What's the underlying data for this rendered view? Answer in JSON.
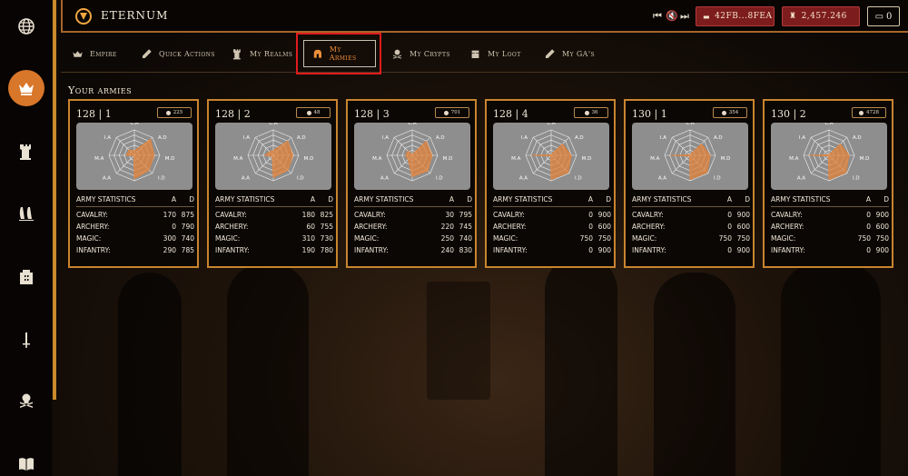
{
  "app": {
    "brand": "ETERNUM",
    "wallet_address": "42FB...8FEA",
    "balance": "2,457.246",
    "wallet_count": "0"
  },
  "sidebar": {
    "items": [
      {
        "icon": "globe-icon",
        "active": false
      },
      {
        "icon": "crown-icon",
        "active": true
      },
      {
        "icon": "tower-icon",
        "active": false
      },
      {
        "icon": "fleet-icon",
        "active": false
      },
      {
        "icon": "building-icon",
        "active": false
      },
      {
        "icon": "sword-icon",
        "active": false
      },
      {
        "icon": "skull-crossbones-icon",
        "active": false
      },
      {
        "icon": "book-icon",
        "active": false
      }
    ]
  },
  "tabs": [
    {
      "label": "Empire",
      "icon": "crown-icon"
    },
    {
      "label": "Quick Actions",
      "icon": "pen-icon"
    },
    {
      "label": "My Realms",
      "icon": "tower-icon"
    },
    {
      "label": "My Armies",
      "icon": "helmet-icon",
      "active": true
    },
    {
      "label": "My Crypts",
      "icon": "skull-crossbones-icon"
    },
    {
      "label": "My Loot",
      "icon": "chest-icon"
    },
    {
      "label": "My GA's",
      "icon": "pen-icon"
    }
  ],
  "section_title": "Your armies",
  "colors": {
    "accent": "#d8762a",
    "border": "#c8842e",
    "highlight": "#e21b1b"
  },
  "stats_headers": {
    "title": "ARMY STATISTICS",
    "attack": "A",
    "defense": "D"
  },
  "radar_labels": [
    "C.A",
    "A.D",
    "M.D",
    "I.D",
    "C.D",
    "A.A",
    "M.A",
    "I.A"
  ],
  "armies": [
    {
      "name": "128 | 1",
      "badge": "225",
      "rows": [
        {
          "label": "CAVALRY:",
          "a": "170",
          "d": "875"
        },
        {
          "label": "ARCHERY:",
          "a": "0",
          "d": "790"
        },
        {
          "label": "MAGIC:",
          "a": "300",
          "d": "740"
        },
        {
          "label": "INFANTRY:",
          "a": "290",
          "d": "785"
        }
      ],
      "radar": [
        0.18,
        0.9,
        0.78,
        0.82,
        0.92,
        0.0,
        0.32,
        0.3
      ]
    },
    {
      "name": "128 | 2",
      "badge": "48",
      "rows": [
        {
          "label": "CAVALRY:",
          "a": "180",
          "d": "825"
        },
        {
          "label": "ARCHERY:",
          "a": "60",
          "d": "755"
        },
        {
          "label": "MAGIC:",
          "a": "310",
          "d": "730"
        },
        {
          "label": "INFANTRY:",
          "a": "190",
          "d": "780"
        }
      ],
      "radar": [
        0.19,
        0.8,
        0.77,
        0.82,
        0.87,
        0.06,
        0.33,
        0.2
      ]
    },
    {
      "name": "128 | 3",
      "badge": "701",
      "rows": [
        {
          "label": "CAVALRY:",
          "a": "30",
          "d": "795"
        },
        {
          "label": "ARCHERY:",
          "a": "220",
          "d": "745"
        },
        {
          "label": "MAGIC:",
          "a": "250",
          "d": "740"
        },
        {
          "label": "INFANTRY:",
          "a": "240",
          "d": "830"
        }
      ],
      "radar": [
        0.03,
        0.78,
        0.78,
        0.87,
        0.84,
        0.23,
        0.26,
        0.25
      ]
    },
    {
      "name": "128 | 4",
      "badge": "36",
      "rows": [
        {
          "label": "CAVALRY:",
          "a": "0",
          "d": "900"
        },
        {
          "label": "ARCHERY:",
          "a": "0",
          "d": "600"
        },
        {
          "label": "MAGIC:",
          "a": "750",
          "d": "750"
        },
        {
          "label": "INFANTRY:",
          "a": "0",
          "d": "900"
        }
      ],
      "radar": [
        0.0,
        0.63,
        0.79,
        0.95,
        0.95,
        0.0,
        0.79,
        0.0
      ]
    },
    {
      "name": "130 | 1",
      "badge": "354",
      "rows": [
        {
          "label": "CAVALRY:",
          "a": "0",
          "d": "900"
        },
        {
          "label": "ARCHERY:",
          "a": "0",
          "d": "600"
        },
        {
          "label": "MAGIC:",
          "a": "750",
          "d": "750"
        },
        {
          "label": "INFANTRY:",
          "a": "0",
          "d": "900"
        }
      ],
      "radar": [
        0.0,
        0.63,
        0.79,
        0.95,
        0.95,
        0.0,
        0.79,
        0.0
      ]
    },
    {
      "name": "130 | 2",
      "badge": "4728",
      "rows": [
        {
          "label": "CAVALRY:",
          "a": "0",
          "d": "900"
        },
        {
          "label": "ARCHERY:",
          "a": "0",
          "d": "600"
        },
        {
          "label": "MAGIC:",
          "a": "750",
          "d": "750"
        },
        {
          "label": "INFANTRY:",
          "a": "0",
          "d": "900"
        }
      ],
      "radar": [
        0.0,
        0.63,
        0.79,
        0.95,
        0.95,
        0.0,
        0.79,
        0.0
      ]
    }
  ]
}
